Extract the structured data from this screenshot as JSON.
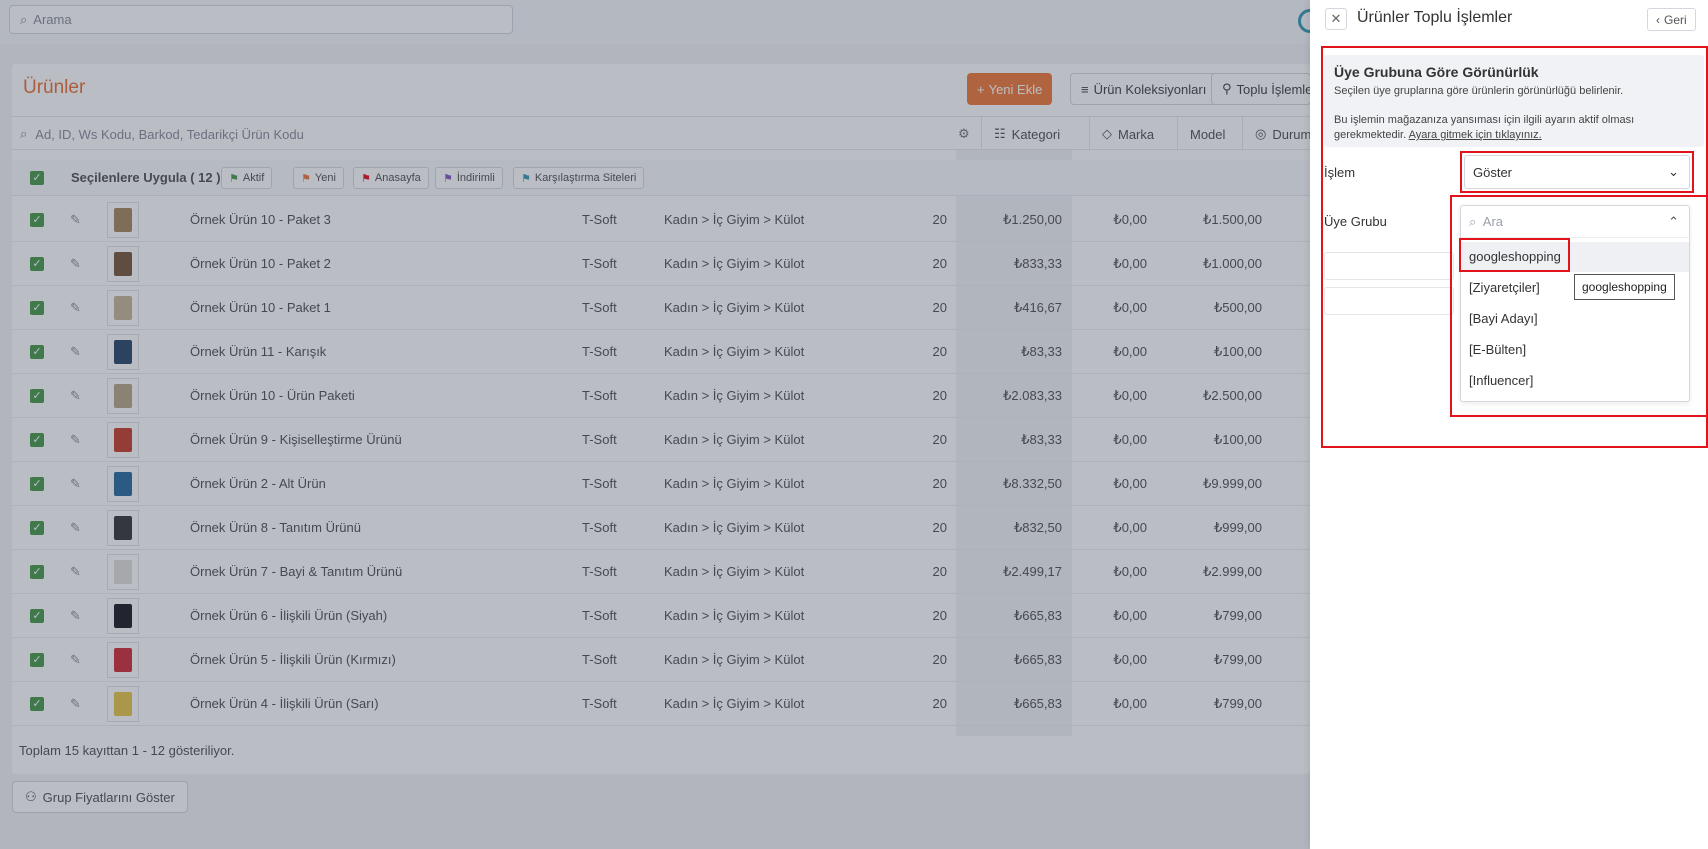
{
  "topbar": {
    "search_placeholder": "Arama"
  },
  "page": {
    "title": "Ürünler",
    "new_button": "Yeni Ekle",
    "collections_button": "Ürün Koleksiyonları",
    "bulk_button": "Toplu İşlemler"
  },
  "filters": {
    "search_placeholder": "Ad, ID, Ws Kodu, Barkod, Tedarikçi Ürün Kodu",
    "category": "Kategori",
    "brand": "Marka",
    "model": "Model",
    "status": "Durum"
  },
  "bulkbar": {
    "apply_label": "Seçilenlere Uygula ( 12 )",
    "tags": [
      "Aktif",
      "Yeni",
      "Anasayfa",
      "İndirimli",
      "Karşılaştırma Siteleri"
    ],
    "tag_colors": [
      "#4a9b4e",
      "#ef7d3c",
      "#e3131b",
      "#8b5cc6",
      "#3a9bb5"
    ]
  },
  "rows": [
    {
      "name": "Örnek Ürün 10 - Paket 3",
      "brand": "T-Soft",
      "category": "Kadın > İç Giyim > Külot",
      "stock": "20",
      "price": "₺1.250,00",
      "discount": "₺0,00",
      "list_price": "₺1.500,00",
      "thumb_color": "#a98a62"
    },
    {
      "name": "Örnek Ürün 10 - Paket 2",
      "brand": "T-Soft",
      "category": "Kadın > İç Giyim > Külot",
      "stock": "20",
      "price": "₺833,33",
      "discount": "₺0,00",
      "list_price": "₺1.000,00",
      "thumb_color": "#7a5a3e"
    },
    {
      "name": "Örnek Ürün 10 - Paket 1",
      "brand": "T-Soft",
      "category": "Kadın > İç Giyim > Külot",
      "stock": "20",
      "price": "₺416,67",
      "discount": "₺0,00",
      "list_price": "₺500,00",
      "thumb_color": "#c9b79a"
    },
    {
      "name": "Örnek Ürün 11 - Karışık",
      "brand": "T-Soft",
      "category": "Kadın > İç Giyim > Külot",
      "stock": "20",
      "price": "₺83,33",
      "discount": "₺0,00",
      "list_price": "₺100,00",
      "thumb_color": "#2f4a6e"
    },
    {
      "name": "Örnek Ürün 10 - Ürün Paketi",
      "brand": "T-Soft",
      "category": "Kadın > İç Giyim > Külot",
      "stock": "20",
      "price": "₺2.083,33",
      "discount": "₺0,00",
      "list_price": "₺2.500,00",
      "thumb_color": "#b8a888"
    },
    {
      "name": "Örnek Ürün 9 - Kişiselleştirme Ürünü",
      "brand": "T-Soft",
      "category": "Kadın > İç Giyim > Külot",
      "stock": "20",
      "price": "₺83,33",
      "discount": "₺0,00",
      "list_price": "₺100,00",
      "thumb_color": "#c8412e"
    },
    {
      "name": "Örnek Ürün 2 - Alt Ürün",
      "brand": "T-Soft",
      "category": "Kadın > İç Giyim > Külot",
      "stock": "20",
      "price": "₺8.332,50",
      "discount": "₺0,00",
      "list_price": "₺9.999,00",
      "thumb_color": "#2d6e9e"
    },
    {
      "name": "Örnek Ürün 8 - Tanıtım Ürünü",
      "brand": "T-Soft",
      "category": "Kadın > İç Giyim > Külot",
      "stock": "20",
      "price": "₺832,50",
      "discount": "₺0,00",
      "list_price": "₺999,00",
      "thumb_color": "#3a3a3a"
    },
    {
      "name": "Örnek Ürün 7 - Bayi & Tanıtım Ürünü",
      "brand": "T-Soft",
      "category": "Kadın > İç Giyim > Külot",
      "stock": "20",
      "price": "₺2.499,17",
      "discount": "₺0,00",
      "list_price": "₺2.999,00",
      "thumb_color": "#e2e0dc"
    },
    {
      "name": "Örnek Ürün 6 - İlişkili Ürün (Siyah)",
      "brand": "T-Soft",
      "category": "Kadın > İç Giyim > Külot",
      "stock": "20",
      "price": "₺665,83",
      "discount": "₺0,00",
      "list_price": "₺799,00",
      "thumb_color": "#1f1f24"
    },
    {
      "name": "Örnek Ürün 5 - İlişkili Ürün (Kırmızı)",
      "brand": "T-Soft",
      "category": "Kadın > İç Giyim > Külot",
      "stock": "20",
      "price": "₺665,83",
      "discount": "₺0,00",
      "list_price": "₺799,00",
      "thumb_color": "#d2303a"
    },
    {
      "name": "Örnek Ürün 4 - İlişkili Ürün (Sarı)",
      "brand": "T-Soft",
      "category": "Kadın > İç Giyim > Külot",
      "stock": "20",
      "price": "₺665,83",
      "discount": "₺0,00",
      "list_price": "₺799,00",
      "thumb_color": "#e8c84a"
    }
  ],
  "footer": {
    "record_info": "Toplam 15 kayıttan 1 - 12 gösteriliyor.",
    "group_price_button": "Grup Fiyatlarını Göster"
  },
  "drawer": {
    "title": "Ürünler Toplu İşlemler",
    "back_label": "Geri",
    "info_title": "Üye Grubuna Göre Görünürlük",
    "info_text_1": "Seçilen üye gruplarına göre ürünlerin görünürlüğü belirlenir.",
    "info_text_2": "Bu işlemin mağazanıza yansıması için ilgili ayarın aktif olması gerekmektedir.",
    "info_link": "Ayara gitmek için tıklayınız.",
    "operation_label": "İşlem",
    "operation_value": "Göster",
    "group_label": "Üye Grubu",
    "group_search_placeholder": "Ara",
    "group_options": [
      "googleshopping",
      "[Ziyaretçiler]",
      "[Bayi Adayı]",
      "[E-Bülten]",
      "[Influencer]"
    ],
    "tooltip": "googleshopping"
  },
  "colors": {
    "accent": "#ef7d3c",
    "highlight": "#e3131b",
    "check": "#4a9b4e"
  }
}
